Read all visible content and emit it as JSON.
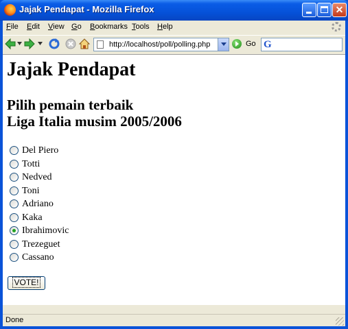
{
  "window": {
    "title": "Jajak Pendapat - Mozilla Firefox"
  },
  "menu": {
    "items": [
      {
        "pre": "",
        "u": "F",
        "post": "ile"
      },
      {
        "pre": "",
        "u": "E",
        "post": "dit"
      },
      {
        "pre": "",
        "u": "V",
        "post": "iew"
      },
      {
        "pre": "",
        "u": "G",
        "post": "o"
      },
      {
        "pre": "",
        "u": "B",
        "post": "ookmarks"
      },
      {
        "pre": "",
        "u": "T",
        "post": "ools"
      },
      {
        "pre": "",
        "u": "H",
        "post": "elp"
      }
    ]
  },
  "toolbar": {
    "url": "http://localhost/poll/polling.php",
    "go_label": "Go",
    "search_value": ""
  },
  "page": {
    "heading": "Jajak Pendapat",
    "subtitle_line1": "Pilih pemain terbaik",
    "subtitle_line2": "Liga Italia musim 2005/2006",
    "options": [
      "Del Piero",
      "Totti",
      "Nedved",
      "Toni",
      "Adriano",
      "Kaka",
      "Ibrahimovic",
      "Trezeguet",
      "Cassano"
    ],
    "selected_option": "Ibrahimovic",
    "vote_label": "VOTE!"
  },
  "status": {
    "text": "Done"
  },
  "colors": {
    "titlebar": "#0552d9",
    "chrome": "#ece9d8",
    "radio_checked": "#21a121"
  },
  "icons": [
    "firefox-icon",
    "back-arrow-icon",
    "forward-arrow-icon",
    "reload-icon",
    "stop-icon",
    "home-icon",
    "page-icon",
    "go-icon",
    "google-icon",
    "throbber-icon"
  ]
}
